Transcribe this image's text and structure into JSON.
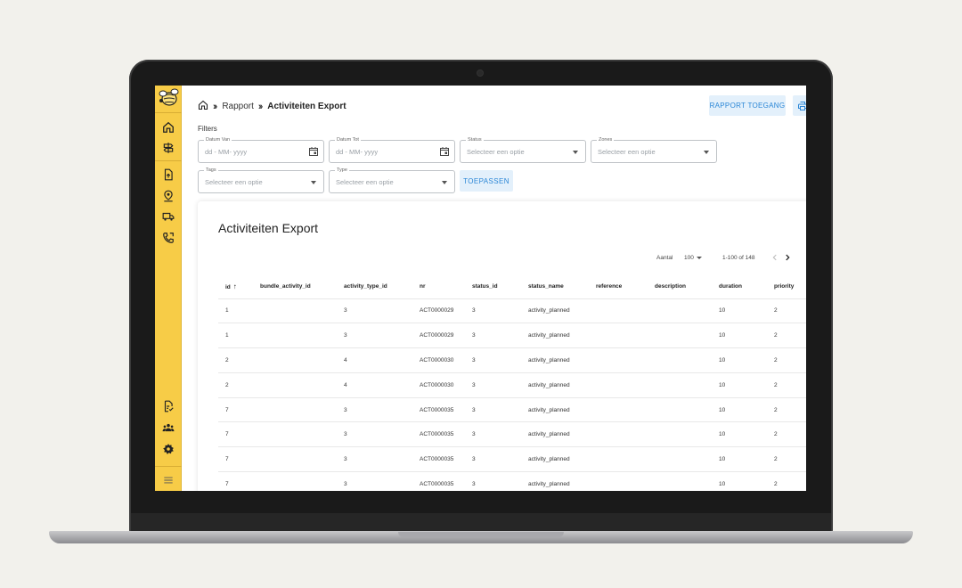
{
  "breadcrumb": {
    "items": [
      "Rapport",
      "Activiteiten Export"
    ]
  },
  "header": {
    "rapport_button": "RAPPORT TOEGANG",
    "print_icon": "printer-icon"
  },
  "filters": {
    "label": "Filters",
    "datum_van": {
      "label": "Datum Van",
      "placeholder": "dd - MM- yyyy"
    },
    "datum_tot": {
      "label": "Datum Tot",
      "placeholder": "dd - MM- yyyy"
    },
    "status": {
      "label": "Status",
      "placeholder": "Selecteer een optie"
    },
    "zones": {
      "label": "Zones",
      "placeholder": "Selecteer een optie"
    },
    "tags": {
      "label": "Tags",
      "placeholder": "Selecteer een optie"
    },
    "type": {
      "label": "Type",
      "placeholder": "Selecteer een optie"
    },
    "apply_button": "TOEPASSEN"
  },
  "card": {
    "title": "Activiteiten Export",
    "pager": {
      "size_label": "Aantal",
      "size_value": "100",
      "range": "1-100 of 148"
    }
  },
  "table": {
    "columns": [
      "id",
      "bundle_activity_id",
      "activity_type_id",
      "nr",
      "status_id",
      "status_name",
      "reference",
      "description",
      "duration",
      "priority"
    ],
    "sort_indicator": "↑",
    "rows": [
      [
        "1",
        "",
        "3",
        "ACT0000029",
        "3",
        "activity_planned",
        "",
        "",
        "10",
        "2"
      ],
      [
        "1",
        "",
        "3",
        "ACT0000029",
        "3",
        "activity_planned",
        "",
        "",
        "10",
        "2"
      ],
      [
        "2",
        "",
        "4",
        "ACT0000030",
        "3",
        "activity_planned",
        "",
        "",
        "10",
        "2"
      ],
      [
        "2",
        "",
        "4",
        "ACT0000030",
        "3",
        "activity_planned",
        "",
        "",
        "10",
        "2"
      ],
      [
        "7",
        "",
        "3",
        "ACT0000035",
        "3",
        "activity_planned",
        "",
        "",
        "10",
        "2"
      ],
      [
        "7",
        "",
        "3",
        "ACT0000035",
        "3",
        "activity_planned",
        "",
        "",
        "10",
        "2"
      ],
      [
        "7",
        "",
        "3",
        "ACT0000035",
        "3",
        "activity_planned",
        "",
        "",
        "10",
        "2"
      ],
      [
        "7",
        "",
        "3",
        "ACT0000035",
        "3",
        "activity_planned",
        "",
        "",
        "10",
        "2"
      ]
    ]
  },
  "sidebar": {
    "icons": [
      "bee-logo-icon",
      "home-icon",
      "signpost-icon",
      "file-upload-icon",
      "location-pin-icon",
      "truck-icon",
      "phone-forward-icon",
      "file-check-icon",
      "people-icon",
      "gear-icon",
      "menu-icon"
    ]
  },
  "colors": {
    "sidebar": "#f7cc47",
    "accent": "#2a86d6",
    "button_bg": "#e3f0fb"
  }
}
